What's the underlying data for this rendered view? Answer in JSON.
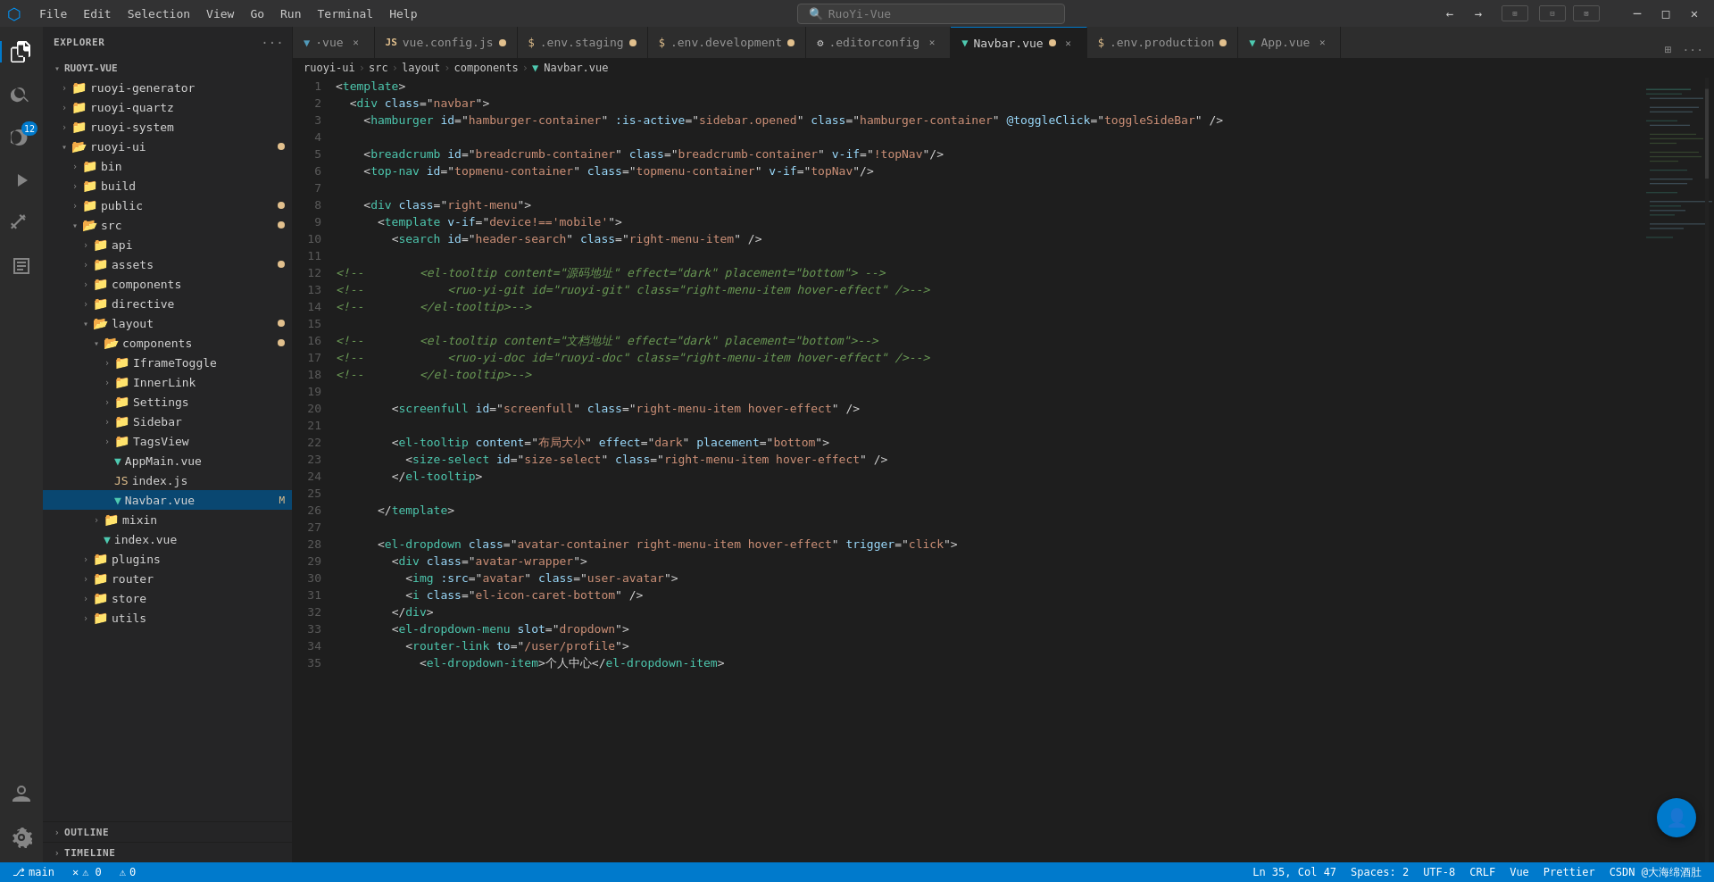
{
  "titlebar": {
    "logo": "⬡",
    "menu_items": [
      "File",
      "Edit",
      "Selection",
      "View",
      "Go",
      "Run",
      "Terminal",
      "Help"
    ],
    "search_placeholder": "RuoYi-Vue",
    "nav_back": "←",
    "nav_forward": "→",
    "btn_minimize": "─",
    "btn_maximize": "□",
    "btn_restore": "❐",
    "btn_close": "✕",
    "window_controls": [
      "▭",
      "▭▭",
      "⧉",
      "⊞"
    ]
  },
  "activity_bar": {
    "icons": [
      {
        "name": "explorer-icon",
        "symbol": "⎘",
        "active": true
      },
      {
        "name": "search-icon",
        "symbol": "🔍",
        "active": false
      },
      {
        "name": "source-control-icon",
        "symbol": "⑂",
        "active": false,
        "badge": "12"
      },
      {
        "name": "run-debug-icon",
        "symbol": "▷",
        "active": false
      },
      {
        "name": "extensions-icon",
        "symbol": "⊞",
        "active": false
      },
      {
        "name": "notebook-icon",
        "symbol": "≡",
        "active": false
      }
    ],
    "bottom_icons": [
      {
        "name": "account-icon",
        "symbol": "👤"
      },
      {
        "name": "settings-icon",
        "symbol": "⚙"
      }
    ]
  },
  "sidebar": {
    "title": "EXPLORER",
    "actions_label": "···",
    "project_root": {
      "label": "RUOYI-VUE",
      "expanded": true,
      "children": [
        {
          "label": "ruoyi-generator",
          "type": "folder",
          "expanded": false,
          "indent": 1
        },
        {
          "label": "ruoyi-quartz",
          "type": "folder",
          "expanded": false,
          "indent": 1
        },
        {
          "label": "ruoyi-system",
          "type": "folder",
          "expanded": false,
          "indent": 1
        },
        {
          "label": "ruoyi-ui",
          "type": "folder",
          "expanded": true,
          "indent": 1,
          "badge": true
        },
        {
          "label": "bin",
          "type": "folder",
          "expanded": false,
          "indent": 2
        },
        {
          "label": "build",
          "type": "folder",
          "expanded": false,
          "indent": 2
        },
        {
          "label": "public",
          "type": "folder",
          "expanded": false,
          "indent": 2,
          "badge": true
        },
        {
          "label": "src",
          "type": "folder",
          "expanded": true,
          "indent": 2,
          "badge": true
        },
        {
          "label": "api",
          "type": "folder",
          "expanded": false,
          "indent": 3
        },
        {
          "label": "assets",
          "type": "folder",
          "expanded": false,
          "indent": 3,
          "badge": true
        },
        {
          "label": "components",
          "type": "folder",
          "expanded": false,
          "indent": 3
        },
        {
          "label": "directive",
          "type": "folder",
          "expanded": false,
          "indent": 3
        },
        {
          "label": "layout",
          "type": "folder",
          "expanded": true,
          "indent": 3,
          "badge": true
        },
        {
          "label": "components",
          "type": "folder",
          "expanded": true,
          "indent": 4,
          "badge": true
        },
        {
          "label": "IframeToggle",
          "type": "folder",
          "expanded": false,
          "indent": 5
        },
        {
          "label": "InnerLink",
          "type": "folder",
          "expanded": false,
          "indent": 5
        },
        {
          "label": "Settings",
          "type": "folder",
          "expanded": false,
          "indent": 5
        },
        {
          "label": "Sidebar",
          "type": "folder",
          "expanded": false,
          "indent": 5
        },
        {
          "label": "TagsView",
          "type": "folder",
          "expanded": false,
          "indent": 5
        },
        {
          "label": "AppMain.vue",
          "type": "vue",
          "expanded": false,
          "indent": 5
        },
        {
          "label": "index.js",
          "type": "js",
          "expanded": false,
          "indent": 5
        },
        {
          "label": "Navbar.vue",
          "type": "vue",
          "expanded": false,
          "indent": 5,
          "active": true,
          "modified": true
        },
        {
          "label": "mixin",
          "type": "folder",
          "expanded": false,
          "indent": 4
        },
        {
          "label": "index.vue",
          "type": "vue",
          "expanded": false,
          "indent": 4
        },
        {
          "label": "plugins",
          "type": "folder",
          "expanded": false,
          "indent": 3
        },
        {
          "label": "router",
          "type": "folder",
          "expanded": false,
          "indent": 3
        },
        {
          "label": "store",
          "type": "folder",
          "expanded": false,
          "indent": 3
        },
        {
          "label": "utils",
          "type": "folder",
          "expanded": false,
          "indent": 3
        }
      ]
    },
    "outline_label": "OUTLINE",
    "timeline_label": "TIMELINE"
  },
  "tabs": [
    {
      "label": "vue",
      "name": "·vue",
      "icon_color": "#519aba",
      "modified": false,
      "active": false
    },
    {
      "label": "vue.config.js",
      "name": "vue.config.js",
      "icon_color": "#e2c08d",
      "modified": true,
      "active": false
    },
    {
      "label": ".env.staging",
      "name": ".env.staging",
      "icon_color": "#e2c08d",
      "modified": true,
      "active": false
    },
    {
      "label": ".env.development",
      "name": ".env.development",
      "icon_color": "#e2c08d",
      "modified": true,
      "active": false
    },
    {
      "label": ".editorconfig",
      "name": ".editorconfig",
      "icon_color": "#cccccc",
      "modified": false,
      "active": false
    },
    {
      "label": "Navbar.vue",
      "name": "Navbar.vue",
      "icon_color": "#4ec9b0",
      "modified": true,
      "active": true
    },
    {
      "label": ".env.production",
      "name": ".env.production",
      "icon_color": "#e2c08d",
      "modified": true,
      "active": false
    },
    {
      "label": "App.vue",
      "name": "App.vue",
      "icon_color": "#4ec9b0",
      "modified": false,
      "active": false
    }
  ],
  "breadcrumb": {
    "items": [
      "ruoyi-ui",
      "src",
      "layout",
      "components",
      "Navbar.vue"
    ]
  },
  "code_lines": [
    {
      "num": 1,
      "content": "<template>"
    },
    {
      "num": 2,
      "content": "  <div class=\"navbar\">"
    },
    {
      "num": 3,
      "content": "    <hamburger id=\"hamburger-container\" :is-active=\"sidebar.opened\" class=\"hamburger-container\" @toggleClick=\"toggleSideBar\" />"
    },
    {
      "num": 4,
      "content": ""
    },
    {
      "num": 5,
      "content": "    <breadcrumb id=\"breadcrumb-container\" class=\"breadcrumb-container\" v-if=\"!topNav\"/>"
    },
    {
      "num": 6,
      "content": "    <top-nav id=\"topmenu-container\" class=\"topmenu-container\" v-if=\"topNav\"/>"
    },
    {
      "num": 7,
      "content": ""
    },
    {
      "num": 8,
      "content": "    <div class=\"right-menu\">"
    },
    {
      "num": 9,
      "content": "      <template v-if=\"device!=='mobile'\">"
    },
    {
      "num": 10,
      "content": "        <search id=\"header-search\" class=\"right-menu-item\" />"
    },
    {
      "num": 11,
      "content": ""
    },
    {
      "num": 12,
      "content": "<!-- <el-tooltip content=\"源码地址\" effect=\"dark\" placement=\"bottom\"> -->"
    },
    {
      "num": 13,
      "content": "<!-- <ruo-yi-git id=\"ruoyi-git\" class=\"right-menu-item hover-effect\" />-->"
    },
    {
      "num": 14,
      "content": "<!-- </el-tooltip>-->"
    },
    {
      "num": 15,
      "content": ""
    },
    {
      "num": 16,
      "content": "<!-- <el-tooltip content=\"文档地址\" effect=\"dark\" placement=\"bottom\">-->"
    },
    {
      "num": 17,
      "content": "<!-- <ruo-yi-doc id=\"ruoyi-doc\" class=\"right-menu-item hover-effect\" />-->"
    },
    {
      "num": 18,
      "content": "<!-- </el-tooltip>-->"
    },
    {
      "num": 19,
      "content": ""
    },
    {
      "num": 20,
      "content": "        <screenfull id=\"screenfull\" class=\"right-menu-item hover-effect\" />"
    },
    {
      "num": 21,
      "content": ""
    },
    {
      "num": 22,
      "content": "        <el-tooltip content=\"布局大小\" effect=\"dark\" placement=\"bottom\">"
    },
    {
      "num": 23,
      "content": "          <size-select id=\"size-select\" class=\"right-menu-item hover-effect\" />"
    },
    {
      "num": 24,
      "content": "        </el-tooltip>"
    },
    {
      "num": 25,
      "content": ""
    },
    {
      "num": 26,
      "content": "      </template>"
    },
    {
      "num": 27,
      "content": ""
    },
    {
      "num": 28,
      "content": "      <el-dropdown class=\"avatar-container right-menu-item hover-effect\" trigger=\"click\">"
    },
    {
      "num": 29,
      "content": "        <div class=\"avatar-wrapper\">"
    },
    {
      "num": 30,
      "content": "          <img :src=\"avatar\" class=\"user-avatar\">"
    },
    {
      "num": 31,
      "content": "          <i class=\"el-icon-caret-bottom\" />"
    },
    {
      "num": 32,
      "content": "        </div>"
    },
    {
      "num": 33,
      "content": "        <el-dropdown-menu slot=\"dropdown\">"
    },
    {
      "num": 34,
      "content": "          <router-link to=\"/user/profile\">"
    },
    {
      "num": 35,
      "content": "            <el-dropdown-item>个人中心</el-dropdown-item>"
    }
  ],
  "statusbar": {
    "left_items": [
      {
        "label": "⎇ main"
      },
      {
        "label": "⚠ 0"
      },
      {
        "label": "✕ 0"
      }
    ],
    "right_items": [
      {
        "label": "Ln 35, Col 47"
      },
      {
        "label": "Spaces: 2"
      },
      {
        "label": "UTF-8"
      },
      {
        "label": "CRLF"
      },
      {
        "label": "Vue"
      },
      {
        "label": "Prettier"
      }
    ],
    "watermark": "CSDN @大海绵酒肚"
  },
  "float_btn": {
    "symbol": "👤"
  }
}
